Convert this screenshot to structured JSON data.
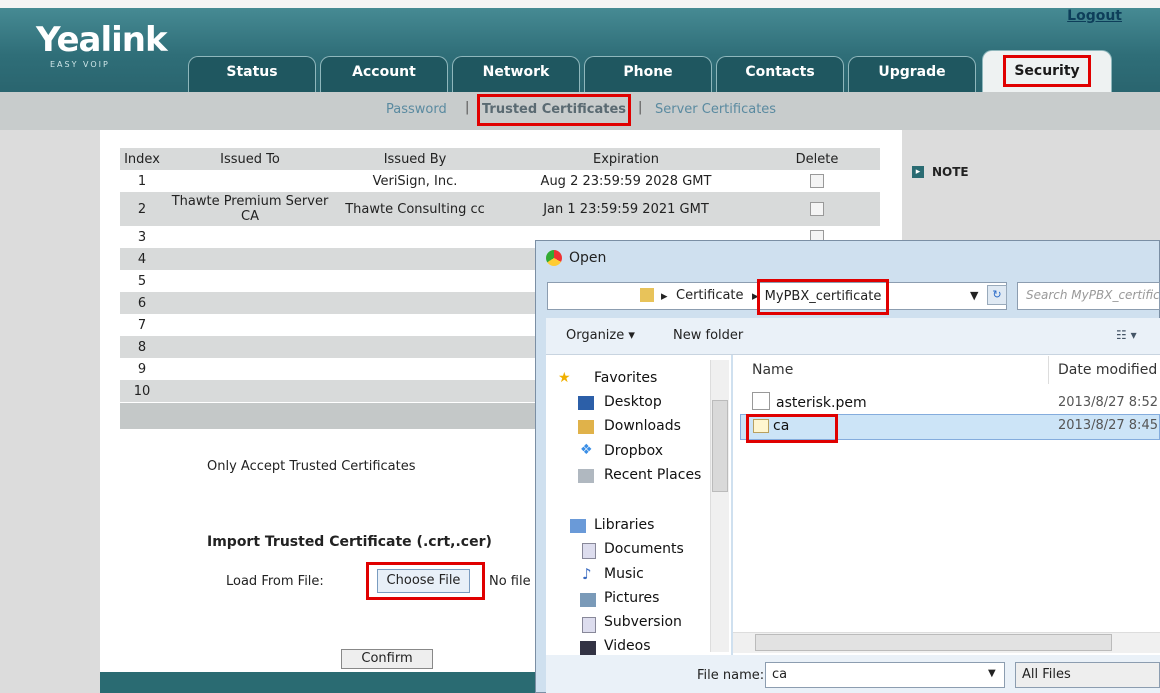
{
  "header": {
    "logo": "Yealink",
    "logo_sub": "EASY VOIP",
    "logout": "Logout",
    "tabs": [
      "Status",
      "Account",
      "Network",
      "Phone",
      "Contacts",
      "Upgrade",
      "Security"
    ],
    "active_tab": "Security"
  },
  "subnav": {
    "items": [
      "Password",
      "Trusted Certificates",
      "Server Certificates"
    ],
    "active": "Trusted Certificates"
  },
  "table": {
    "headers": [
      "Index",
      "Issued To",
      "Issued By",
      "Expiration",
      "Delete"
    ],
    "rows": [
      {
        "index": "1",
        "issued_to": "",
        "issued_by": "VeriSign, Inc.",
        "expiration": "Aug 2 23:59:59 2028 GMT"
      },
      {
        "index": "2",
        "issued_to": "Thawte Premium Server CA",
        "issued_by": "Thawte Consulting cc",
        "expiration": "Jan 1 23:59:59 2021 GMT"
      },
      {
        "index": "3",
        "issued_to": "",
        "issued_by": "",
        "expiration": ""
      },
      {
        "index": "4",
        "issued_to": "",
        "issued_by": "",
        "expiration": ""
      },
      {
        "index": "5",
        "issued_to": "",
        "issued_by": "",
        "expiration": ""
      },
      {
        "index": "6",
        "issued_to": "",
        "issued_by": "",
        "expiration": ""
      },
      {
        "index": "7",
        "issued_to": "",
        "issued_by": "",
        "expiration": ""
      },
      {
        "index": "8",
        "issued_to": "",
        "issued_by": "",
        "expiration": ""
      },
      {
        "index": "9",
        "issued_to": "",
        "issued_by": "",
        "expiration": ""
      },
      {
        "index": "10",
        "issued_to": "",
        "issued_by": "",
        "expiration": ""
      }
    ]
  },
  "note": "NOTE",
  "only_accept": "Only Accept Trusted Certificates",
  "import": {
    "title": "Import Trusted Certificate (.crt,.cer)",
    "load_label": "Load From File:",
    "choose_button": "Choose File",
    "no_file": "No file ch",
    "confirm": "Confirm"
  },
  "dialog": {
    "title": "Open",
    "breadcrumb": [
      "Certificate",
      "MyPBX_certificate"
    ],
    "search_placeholder": "Search MyPBX_certificate",
    "toolbar": {
      "organize": "Organize ▾",
      "new_folder": "New folder"
    },
    "columns": {
      "name": "Name",
      "date": "Date modified"
    },
    "favorites_label": "Favorites",
    "favorites": [
      "Desktop",
      "Downloads",
      "Dropbox",
      "Recent Places"
    ],
    "libraries_label": "Libraries",
    "libraries": [
      "Documents",
      "Music",
      "Pictures",
      "Subversion",
      "Videos"
    ],
    "files": [
      {
        "name": "asterisk.pem",
        "date": "2013/8/27 8:52"
      },
      {
        "name": "ca",
        "date": "2013/8/27 8:45"
      }
    ],
    "file_name_label": "File name:",
    "file_name_value": "ca",
    "file_type": "All Files"
  },
  "colors": {
    "highlight_red": "#e00000",
    "header_teal": "#2f6e78",
    "selected_row": "#cce4f7"
  }
}
